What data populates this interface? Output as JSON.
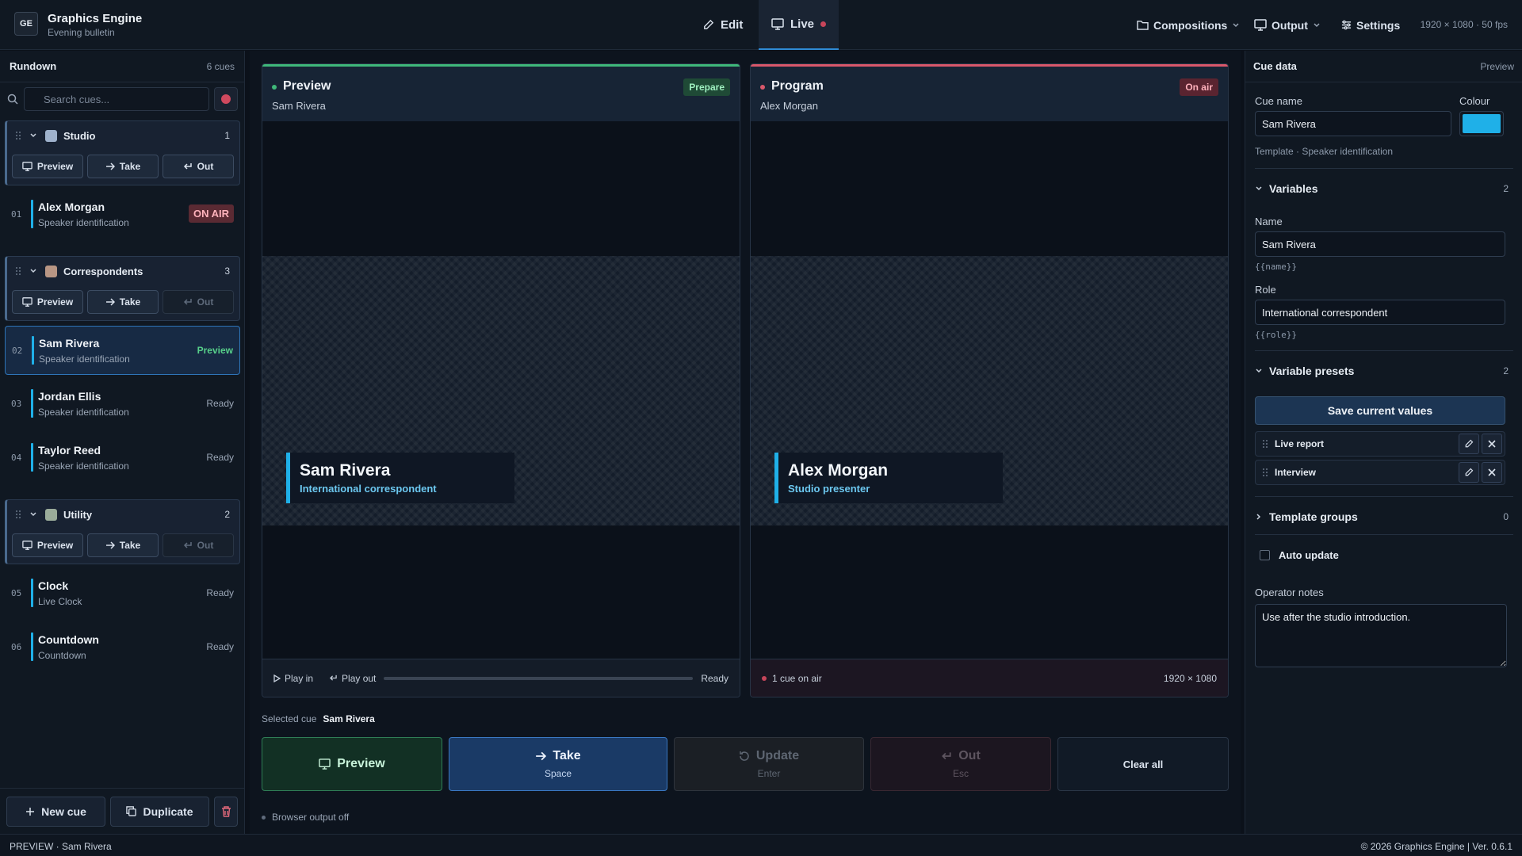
{
  "app": {
    "logo": "GE",
    "title": "Graphics Engine",
    "subtitle": "Evening bulletin"
  },
  "modes": [
    {
      "label": "Edit"
    },
    {
      "label": "Live"
    }
  ],
  "nav": {
    "compositions": "Compositions",
    "output": "Output",
    "settings": "Settings",
    "resolution": "1920 × 1080 · 50 fps"
  },
  "rundown": {
    "title": "Rundown",
    "count": "6 cues",
    "search_placeholder": "Search cues...",
    "btn_preview": "Preview",
    "btn_take": "Take",
    "btn_out": "Out",
    "groups": [
      {
        "name": "Studio",
        "count": "1",
        "color": "#9fb2cc"
      },
      {
        "name": "Correspondents",
        "count": "3",
        "color": "#b89684"
      },
      {
        "name": "Utility",
        "count": "2",
        "color": "#9aac9a"
      }
    ],
    "cues": [
      {
        "num": "01",
        "title": "Alex Morgan",
        "subtitle": "Speaker identification",
        "status": "ON AIR"
      },
      {
        "num": "02",
        "title": "Sam Rivera",
        "subtitle": "Speaker identification",
        "status": "Preview"
      },
      {
        "num": "03",
        "title": "Jordan Ellis",
        "subtitle": "Speaker identification",
        "status": "Ready"
      },
      {
        "num": "04",
        "title": "Taylor Reed",
        "subtitle": "Speaker identification",
        "status": "Ready"
      },
      {
        "num": "05",
        "title": "Clock",
        "subtitle": "Live Clock",
        "status": "Ready"
      },
      {
        "num": "06",
        "title": "Countdown",
        "subtitle": "Countdown",
        "status": "Ready"
      }
    ],
    "footer": {
      "new_cue": "New cue",
      "duplicate": "Duplicate"
    }
  },
  "preview": {
    "title": "Preview",
    "subtitle": "Sam Rivera",
    "badge": "Prepare",
    "lt_name": "Sam Rivera",
    "lt_role": "International correspondent",
    "play_in": "Play in",
    "play_out": "Play out",
    "state": "Ready",
    "progress": 0
  },
  "program": {
    "title": "Program",
    "subtitle": "Alex Morgan",
    "badge": "On air",
    "lt_name": "Alex Morgan",
    "lt_role": "Studio presenter",
    "on_air": "1 cue on air",
    "resolution": "1920 × 1080"
  },
  "actions": {
    "selected_label": "Selected cue",
    "selected_value": "Sam Rivera",
    "preview": "Preview",
    "take": "Take",
    "take_key": "Space",
    "update": "Update",
    "update_key": "Enter",
    "out": "Out",
    "out_key": "Esc",
    "clear": "Clear all",
    "browser_output": "Browser output off"
  },
  "cue_data": {
    "title": "Cue data",
    "mode": "Preview",
    "cue_name_label": "Cue name",
    "cue_name": "Sam Rivera",
    "colour_label": "Colour",
    "colour": "#1fb0e8",
    "template": "Template · Speaker identification",
    "variables": {
      "title": "Variables",
      "count": "2",
      "items": [
        {
          "label": "Name",
          "value": "Sam Rivera",
          "token": "{{name}}"
        },
        {
          "label": "Role",
          "value": "International correspondent",
          "token": "{{role}}"
        }
      ]
    },
    "presets": {
      "title": "Variable presets",
      "count": "2",
      "save": "Save current values",
      "items": [
        {
          "name": "Live report"
        },
        {
          "name": "Interview"
        }
      ]
    },
    "template_groups": {
      "title": "Template groups",
      "count": "0"
    },
    "auto_update": "Auto update",
    "notes_label": "Operator notes",
    "notes": "Use after the studio introduction."
  },
  "status": {
    "left": "PREVIEW · Sam Rivera",
    "right": "© 2026 Graphics Engine | Ver. 0.6.1"
  },
  "colors": {
    "accent": "#2f8bd6",
    "on_air": "#d9586b",
    "preview": "#3fb87a",
    "lower_third": "#1fb0e8"
  },
  "icons": [
    "edit-icon",
    "monitor-icon",
    "folder-icon",
    "sliders-icon",
    "search-icon",
    "drag-handle-icon",
    "chevron-down-icon",
    "arrow-right-icon",
    "return-icon",
    "plus-icon",
    "copy-icon",
    "trash-icon",
    "play-icon",
    "refresh-icon",
    "pencil-icon",
    "close-icon",
    "chevron-right-icon"
  ]
}
